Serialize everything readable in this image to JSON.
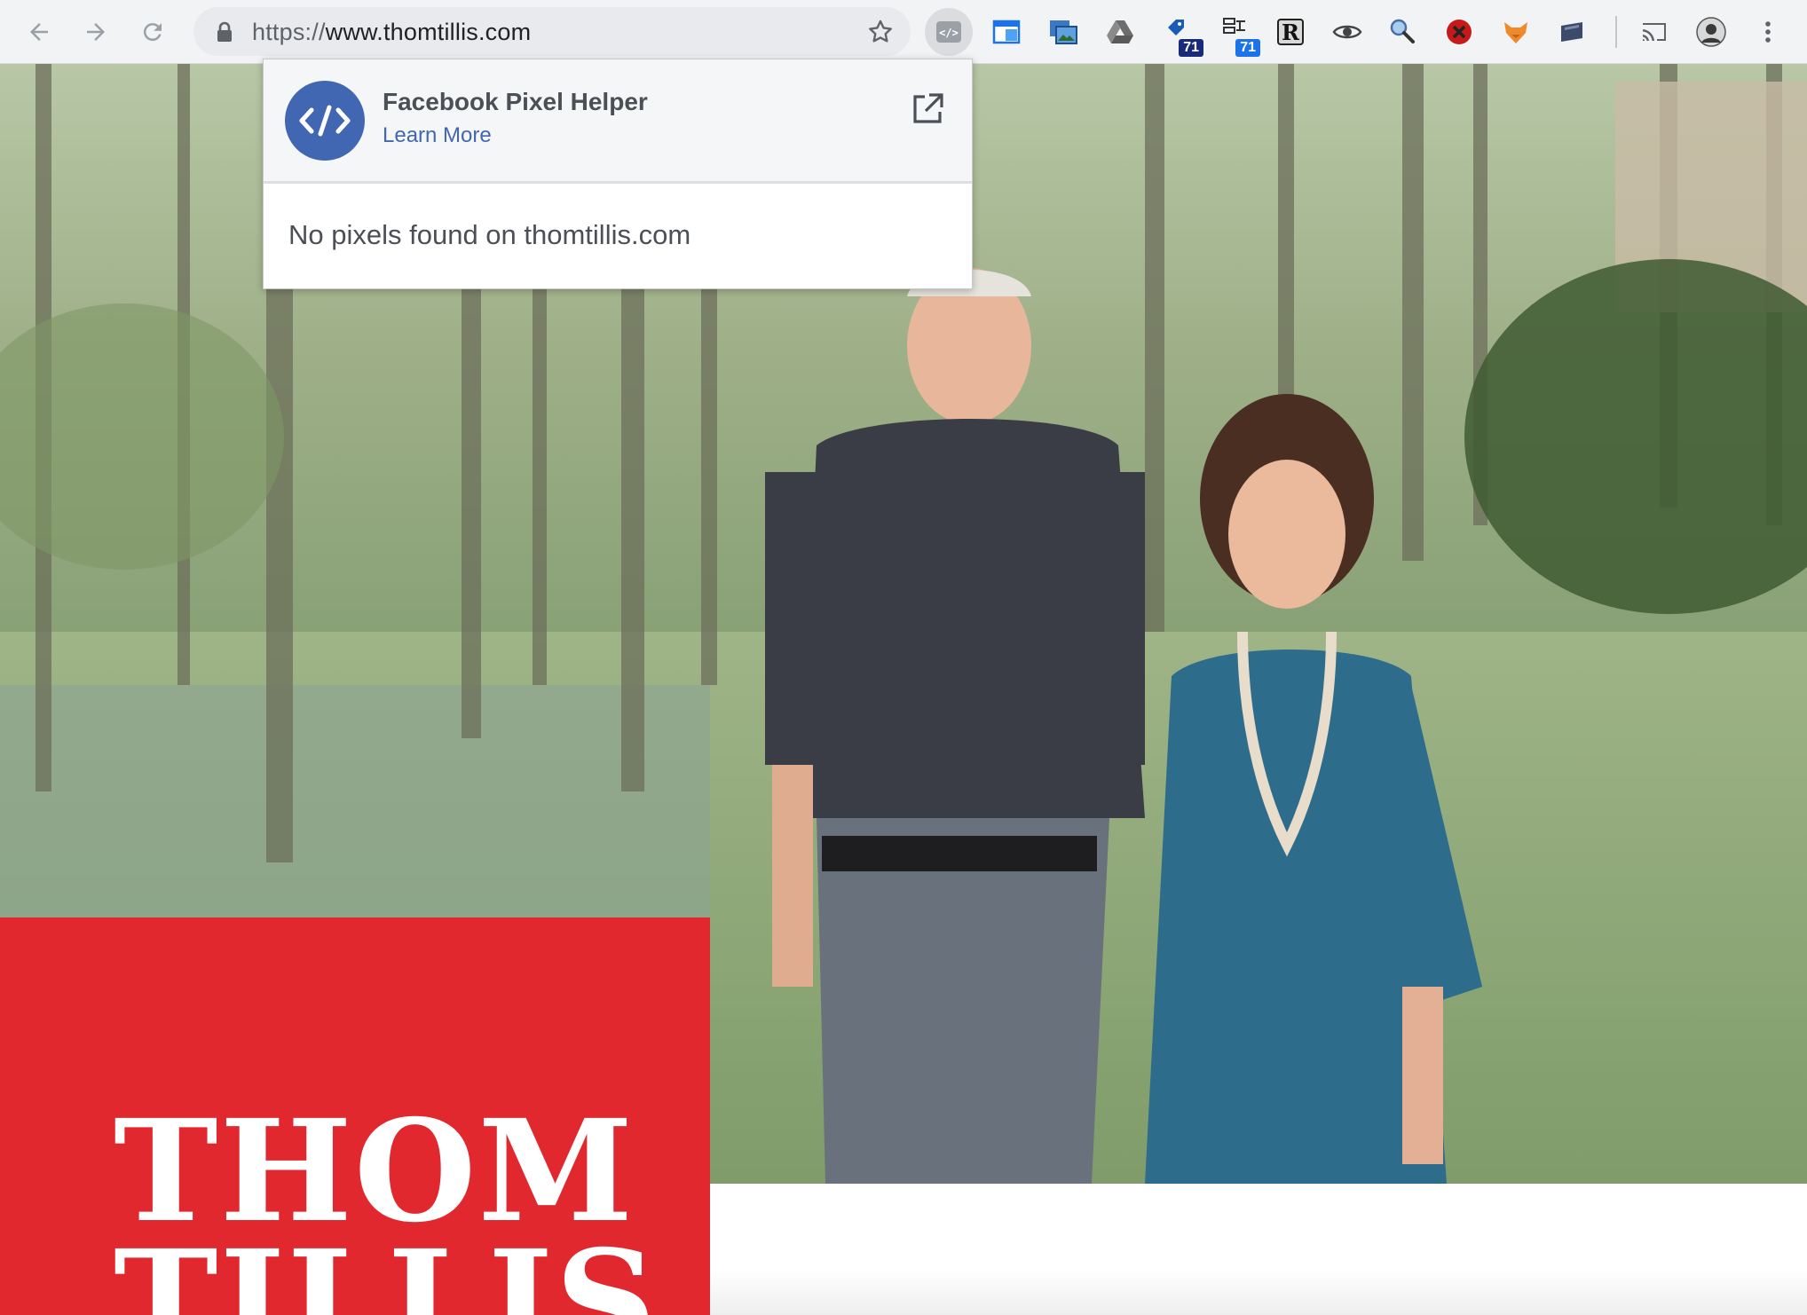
{
  "browser": {
    "url_scheme": "https://",
    "url_host": "www.thomtillis.com",
    "extensions": [
      {
        "name": "facebook-pixel-helper-icon",
        "active": true
      },
      {
        "name": "window-icon"
      },
      {
        "name": "screenshot-icon"
      },
      {
        "name": "google-drive-icon"
      },
      {
        "name": "tag-icon",
        "badge": "71"
      },
      {
        "name": "sitemap-icon",
        "badge": "71"
      },
      {
        "name": "r-letter-icon",
        "glyph": "R"
      },
      {
        "name": "eye-icon"
      },
      {
        "name": "magnifier-icon"
      },
      {
        "name": "blocker-icon"
      },
      {
        "name": "fox-icon"
      },
      {
        "name": "card-icon"
      }
    ]
  },
  "popup": {
    "title": "Facebook Pixel Helper",
    "link": "Learn More",
    "message": "No pixels found on thomtillis.com"
  },
  "page": {
    "logo_line1": "THOM",
    "logo_line2": "TILLIS"
  },
  "colors": {
    "brand_red": "#e1282f",
    "facebook_blue": "#4267b2",
    "toolbar_bg": "#f1f3f4"
  }
}
